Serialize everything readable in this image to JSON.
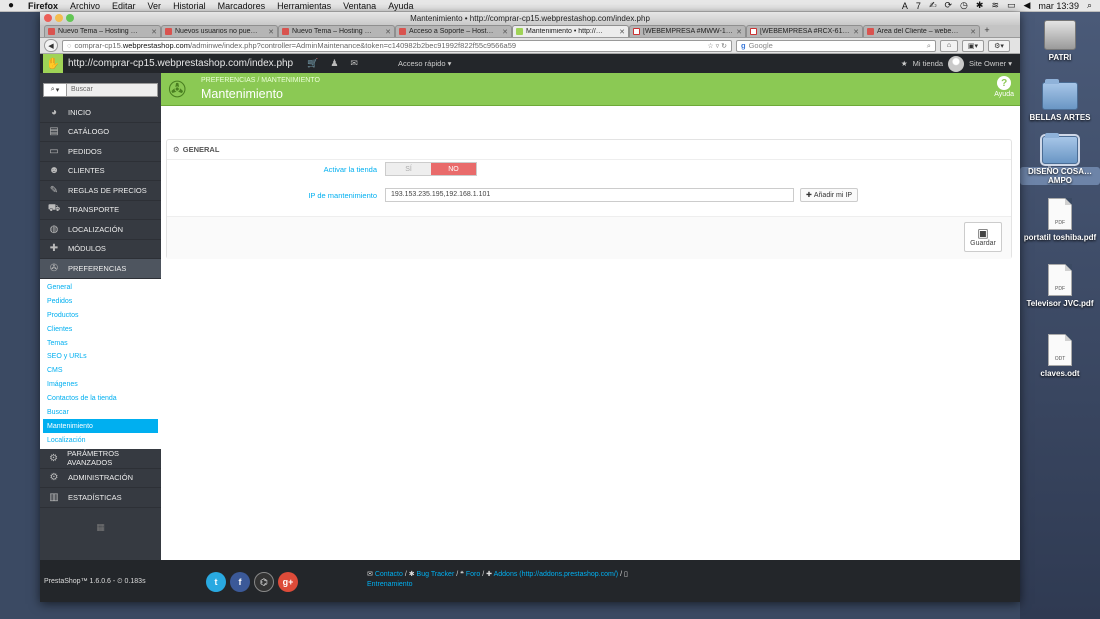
{
  "menubar": {
    "apple": "",
    "items": [
      "Firefox",
      "Archivo",
      "Editar",
      "Ver",
      "Historial",
      "Marcadores",
      "Herramientas",
      "Ventana",
      "Ayuda"
    ],
    "status": "7",
    "clock": "mar 13:39"
  },
  "window": {
    "title": "Mantenimiento • http://comprar-cp15.webprestashop.com/index.php",
    "tabs": [
      {
        "label": "Nuevo Tema – Hosting …",
        "active": false
      },
      {
        "label": "Nuevos usuarios no pue…",
        "active": false
      },
      {
        "label": "Nuevo Tema – Hosting …",
        "active": false
      },
      {
        "label": "Acceso a Soporte – Host…",
        "active": false
      },
      {
        "label": "Mantenimiento • http://…",
        "active": true
      },
      {
        "label": "[WEBEMPRESA #MWW-1…",
        "active": false
      },
      {
        "label": "[WEBEMPRESA #RCX-61…",
        "active": false
      },
      {
        "label": "Área del Cliente – webe…",
        "active": false
      }
    ],
    "url_prefix": "comprar-cp15.",
    "url_domain": "webprestashop.com",
    "url_path": "/adminwe/index.php?controller=AdminMaintenance&token=c140982b2bec91992f822f55c9566a59",
    "search_placeholder": "Google"
  },
  "ps": {
    "header_url": "http://comprar-cp15.webprestashop.com/index.php",
    "quick_access": "Acceso rápido ▾",
    "my_shop": "Mi tienda",
    "owner": "Site Owner ▾",
    "search_placeholder": "Buscar",
    "menu_top": [
      {
        "label": "INICIO",
        "icon": "◕"
      },
      {
        "label": "CATÁLOGO",
        "icon": "▤"
      },
      {
        "label": "PEDIDOS",
        "icon": "▭"
      },
      {
        "label": "CLIENTES",
        "icon": "☻"
      },
      {
        "label": "REGLAS DE PRECIOS",
        "icon": "✎"
      },
      {
        "label": "TRANSPORTE",
        "icon": "⛟"
      },
      {
        "label": "LOCALIZACIÓN",
        "icon": "◍"
      },
      {
        "label": "MÓDULOS",
        "icon": "✚"
      },
      {
        "label": "PREFERENCIAS",
        "icon": "✇"
      }
    ],
    "submenu": [
      "General",
      "Pedidos",
      "Productos",
      "Clientes",
      "Temas",
      "SEO y URLs",
      "CMS",
      "Imágenes",
      "Contactos de la tienda",
      "Buscar",
      "Mantenimiento",
      "Localización"
    ],
    "submenu_active": "Mantenimiento",
    "menu_bottom": [
      {
        "label": "PARÁMETROS AVANZADOS",
        "icon": "⚙"
      },
      {
        "label": "ADMINISTRACIÓN",
        "icon": "⚙"
      },
      {
        "label": "ESTADÍSTICAS",
        "icon": "▥"
      }
    ],
    "breadcrumb": "PREFERENCIAS  /  MANTENIMIENTO",
    "page_title": "Mantenimiento",
    "help_label": "Ayuda",
    "panel_title": "GENERAL",
    "field_shop_label": "Activar la tienda",
    "switch_yes": "SÍ",
    "switch_no": "NO",
    "field_ip_label": "IP de mantenimiento",
    "ip_value": "193.153.235.195,192.168.1.101",
    "add_ip_label": "Añadir mi IP",
    "save_label": "Guardar",
    "version": "PrestaShop™ 1.6.0.6 - ⏲ 0.183s",
    "footer_links": {
      "contact": "Contacto",
      "bug": "Bug Tracker",
      "forum": "Foro",
      "addons": "Addons (http://addons.prestashop.com/)",
      "training": "Entrenamiento"
    },
    "social": [
      "t",
      "f",
      "⌬",
      "g+"
    ]
  },
  "desktop": [
    {
      "label": "PATRI",
      "kind": "hd"
    },
    {
      "label": "BELLAS ARTES",
      "kind": "folder"
    },
    {
      "label": "DISEÑO COSA…AMPO",
      "kind": "folder-sel"
    },
    {
      "label": "portatil toshiba.pdf",
      "kind": "pdf",
      "ext": "PDF"
    },
    {
      "label": "Televisor JVC.pdf",
      "kind": "pdf",
      "ext": "PDF"
    },
    {
      "label": "claves.odt",
      "kind": "odt",
      "ext": "ODT"
    }
  ],
  "colors": {
    "accent_green": "#8bc954",
    "link_blue": "#00aff0",
    "off_red": "#e96b6b",
    "dark_bar": "#23262a"
  }
}
